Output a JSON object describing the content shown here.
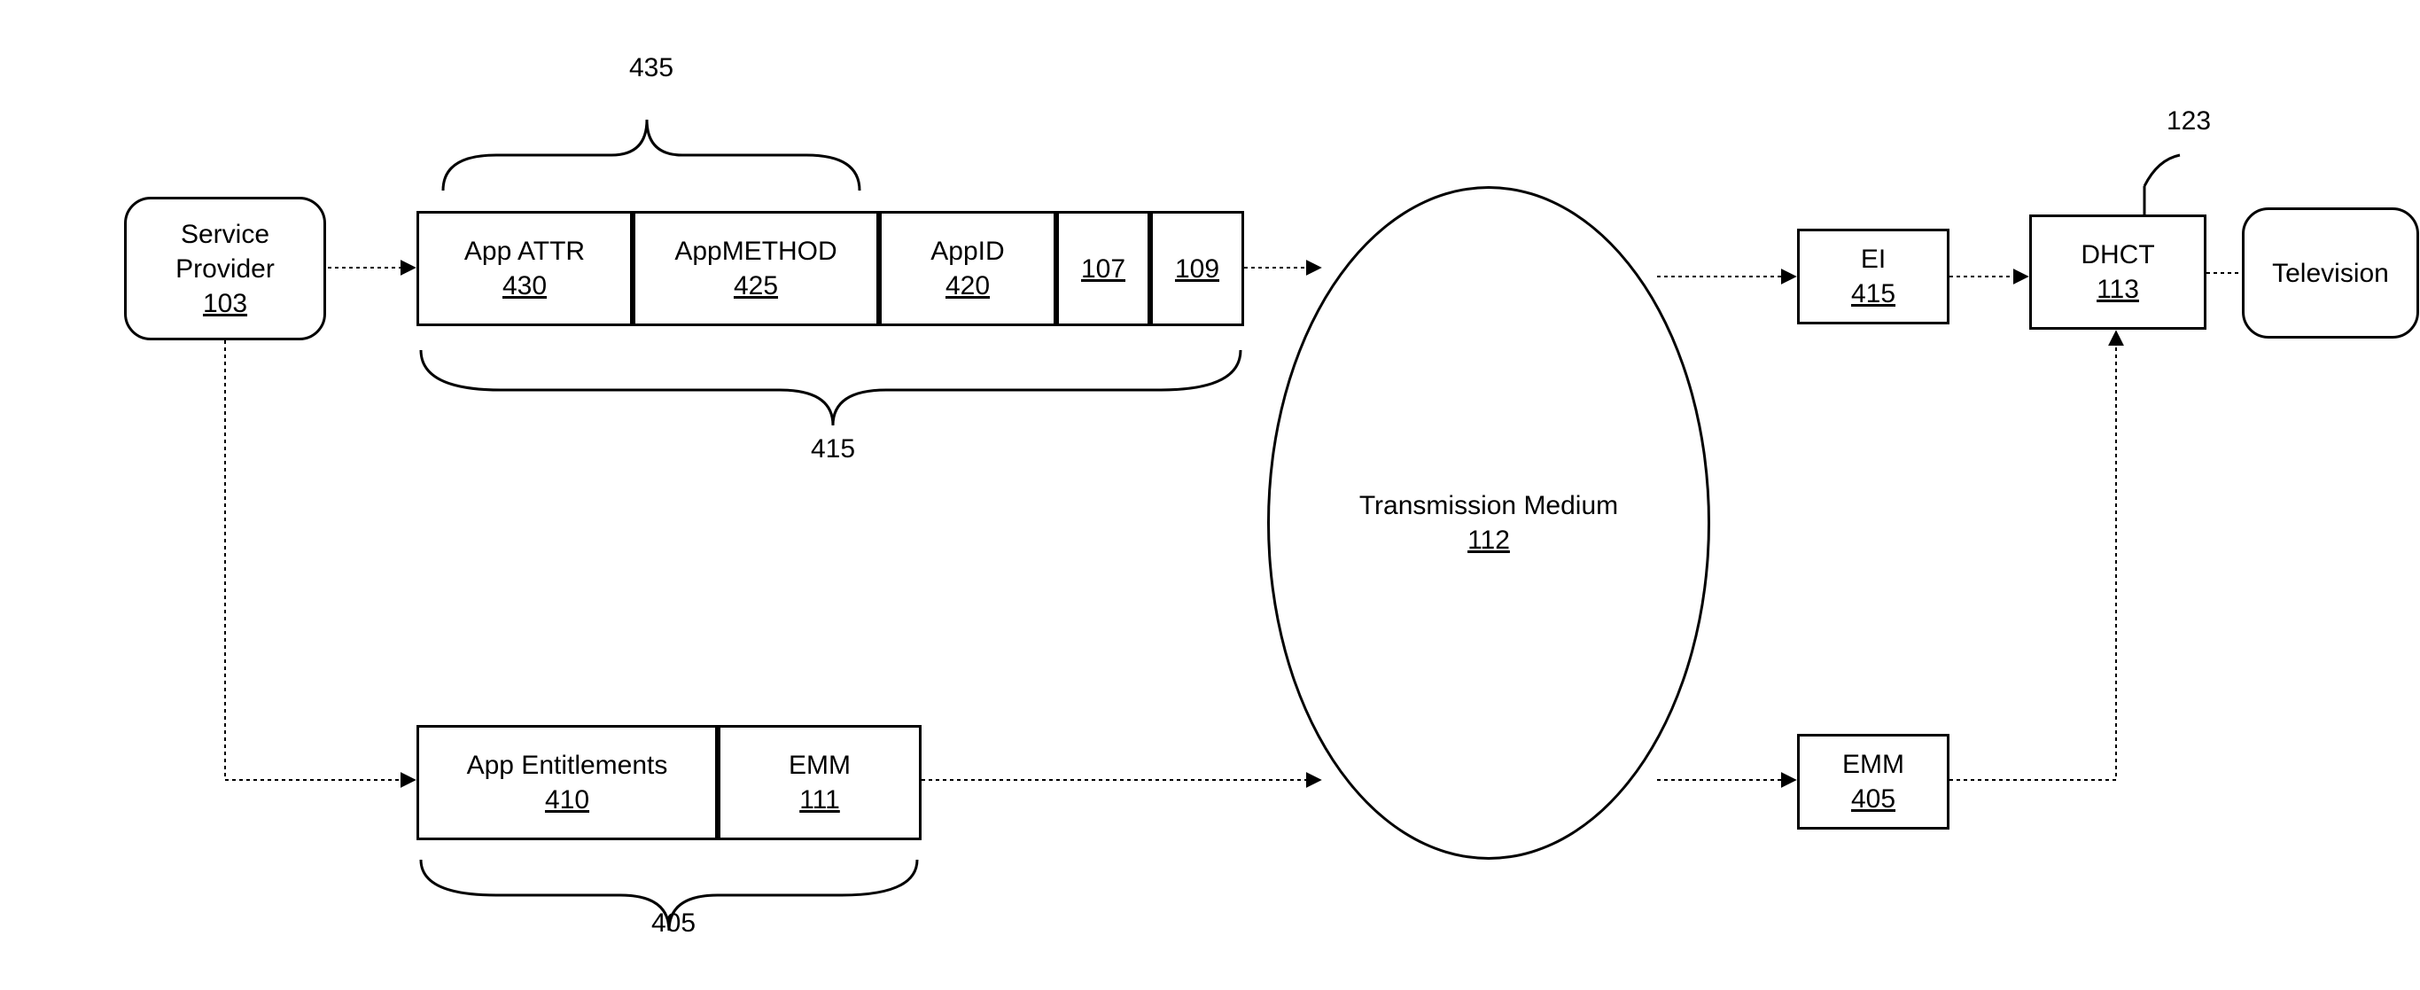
{
  "labels": {
    "num_435": "435",
    "num_415": "415",
    "num_405": "405",
    "num_123": "123"
  },
  "serviceProvider": {
    "title": "Service\nProvider",
    "ref": "103"
  },
  "packet_435": {
    "appAttr": {
      "title": "App ATTR",
      "ref": "430"
    },
    "appMethod": {
      "title": "AppMETHOD",
      "ref": "425"
    },
    "appId": {
      "title": "AppID",
      "ref": "420"
    },
    "n107": "107",
    "n109": "109"
  },
  "packet_405": {
    "entitlements": {
      "title": "App Entitlements",
      "ref": "410"
    },
    "emm": {
      "title": "EMM",
      "ref": "111"
    }
  },
  "transmission": {
    "title": "Transmission Medium",
    "ref": "112"
  },
  "right": {
    "ei": {
      "title": "EI",
      "ref": "415"
    },
    "emm": {
      "title": "EMM",
      "ref": "405"
    },
    "dhct": {
      "title": "DHCT",
      "ref": "113"
    },
    "tv": {
      "title": "Television"
    }
  }
}
